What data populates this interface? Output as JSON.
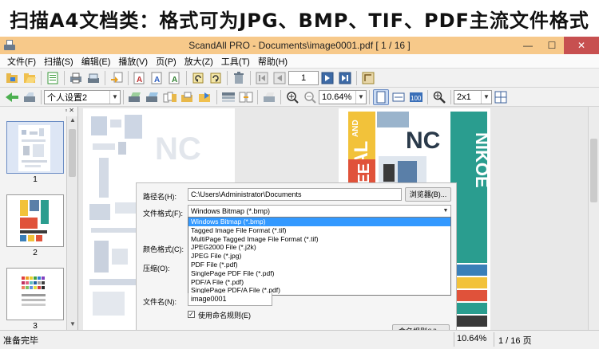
{
  "banner": {
    "text": "扫描A4文档类：格式可为JPG、BMP、TIF、PDF主流文件格式"
  },
  "window": {
    "title": "ScandAll PRO - Documents\\image0001.pdf  [ 1 / 16 ]",
    "controls": {
      "minimize": "—",
      "maximize": "☐",
      "close": "✕"
    }
  },
  "menu": [
    "文件(F)",
    "扫描(S)",
    "编辑(E)",
    "播放(V)",
    "页(P)",
    "放大(Z)",
    "工具(T)",
    "帮助(H)"
  ],
  "toolbar": {
    "page_input": "1",
    "profile_select": "个人设置2",
    "zoom_select": "10.64%",
    "layout_select": "2x1"
  },
  "thumbnails": [
    {
      "num": "1"
    },
    {
      "num": "2"
    },
    {
      "num": "3"
    }
  ],
  "dialog": {
    "path_label": "路径名(H):",
    "path_value": "C:\\Users\\Administrator\\Documents",
    "browse_button": "浏览器(B)...",
    "format_label": "文件格式(F):",
    "format_value": "Windows Bitmap (*.bmp)",
    "color_label": "颜色格式(C):",
    "compress_label": "压缩(O):",
    "filename_label": "文件名(N):",
    "filename_value": "image0001",
    "naming_checkbox": "使用命名规则(E)",
    "naming_button": "命名规则(U)...",
    "format_options": [
      "Windows Bitmap (*.bmp)",
      "Tagged Image File Format (*.tif)",
      "MultiPage Tagged Image File Format (*.tif)",
      "JPEG2000 File (*.j2k)",
      "JPEG File (*.jpg)",
      "PDF File (*.pdf)",
      "SinglePage PDF File (*.pdf)",
      "PDF/A File (*.pdf)",
      "SinglePage PDF/A File (*.pdf)"
    ]
  },
  "status": {
    "text": "准备完毕",
    "zoom": "10.64%",
    "page": "1 / 16 页"
  },
  "poster": {
    "nikoe": "NIKOE",
    "cal": "CAL",
    "kee": "KEE",
    "and": "AND",
    "nc": "NC"
  },
  "colors": {
    "titlebar": "#f7c98a",
    "close": "#c75050",
    "selection": "#3399ff",
    "poster_yellow": "#f2c23a",
    "poster_red": "#e0523a",
    "poster_blue": "#3a7fb8",
    "poster_teal": "#2a9d8f"
  }
}
